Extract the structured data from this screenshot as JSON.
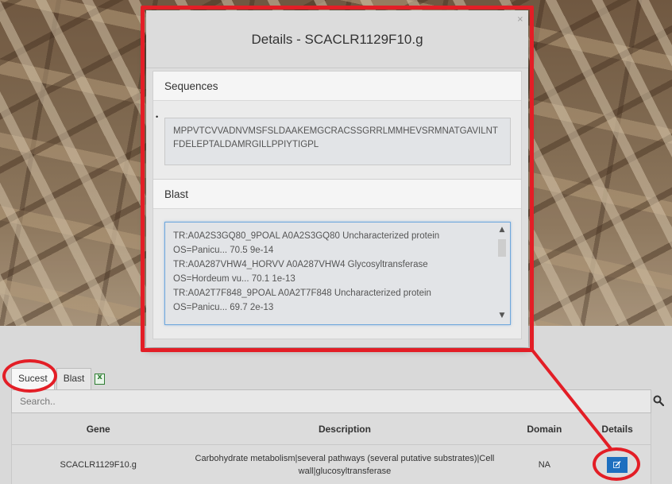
{
  "modal": {
    "title": "Details - SCACLR1129F10.g",
    "close_glyph": "×",
    "sequences": {
      "heading": "Sequences",
      "bullet": "•",
      "text": "MPPVTCVVADNVMSFSLDAAKEMGCRACSSGRRLMMHEVSRMNATGAVILNTFDELEPTALDAMRGILLPPIYTIGPL"
    },
    "blast": {
      "heading": "Blast",
      "lines": [
        "TR:A0A2S3GQ80_9POAL  A0A2S3GQ80 Uncharacterized protein",
        "OS=Panicu...  70.5   9e-14",
        "TR:A0A287VHW4_HORVV  A0A287VHW4 Glycosyltransferase",
        "OS=Hordeum vu...  70.1   1e-13",
        "TR:A0A2T7F848_9POAL  A0A2T7F848 Uncharacterized protein",
        "OS=Panicu...  69.7   2e-13"
      ]
    }
  },
  "tabs": {
    "sucest": "Sucest",
    "blast": "Blast"
  },
  "search": {
    "placeholder": "Search.."
  },
  "table": {
    "headers": {
      "gene": "Gene",
      "description": "Description",
      "domain": "Domain",
      "details": "Details"
    },
    "rows": [
      {
        "gene": "SCACLR1129F10.g",
        "description": "Carbohydrate metabolism|several pathways (several putative substrates)|Cell wall|glucosyltransferase",
        "domain": "NA"
      }
    ]
  },
  "colors": {
    "annotation": "#e31e26",
    "details_button": "#1e6fbf"
  },
  "icons": [
    "search-icon",
    "excel-icon",
    "edit-icon",
    "close-icon",
    "chevron-up-icon",
    "chevron-down-icon"
  ]
}
